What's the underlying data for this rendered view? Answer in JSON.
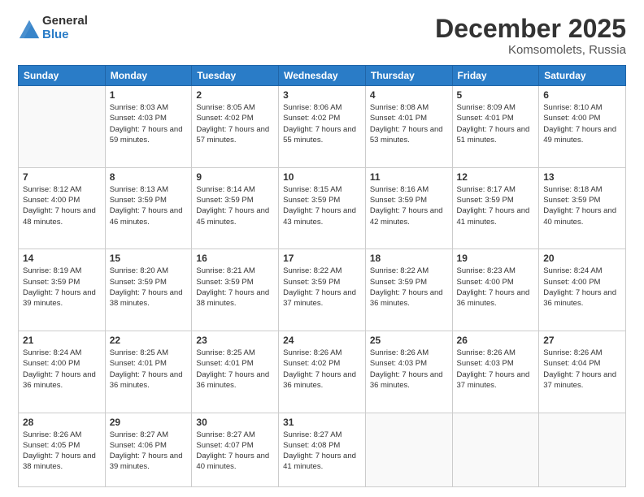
{
  "logo": {
    "general": "General",
    "blue": "Blue"
  },
  "header": {
    "month": "December 2025",
    "location": "Komsomolets, Russia"
  },
  "weekdays": [
    "Sunday",
    "Monday",
    "Tuesday",
    "Wednesday",
    "Thursday",
    "Friday",
    "Saturday"
  ],
  "weeks": [
    [
      {
        "day": "",
        "sunrise": "",
        "sunset": "",
        "daylight": ""
      },
      {
        "day": "1",
        "sunrise": "Sunrise: 8:03 AM",
        "sunset": "Sunset: 4:03 PM",
        "daylight": "Daylight: 7 hours and 59 minutes."
      },
      {
        "day": "2",
        "sunrise": "Sunrise: 8:05 AM",
        "sunset": "Sunset: 4:02 PM",
        "daylight": "Daylight: 7 hours and 57 minutes."
      },
      {
        "day": "3",
        "sunrise": "Sunrise: 8:06 AM",
        "sunset": "Sunset: 4:02 PM",
        "daylight": "Daylight: 7 hours and 55 minutes."
      },
      {
        "day": "4",
        "sunrise": "Sunrise: 8:08 AM",
        "sunset": "Sunset: 4:01 PM",
        "daylight": "Daylight: 7 hours and 53 minutes."
      },
      {
        "day": "5",
        "sunrise": "Sunrise: 8:09 AM",
        "sunset": "Sunset: 4:01 PM",
        "daylight": "Daylight: 7 hours and 51 minutes."
      },
      {
        "day": "6",
        "sunrise": "Sunrise: 8:10 AM",
        "sunset": "Sunset: 4:00 PM",
        "daylight": "Daylight: 7 hours and 49 minutes."
      }
    ],
    [
      {
        "day": "7",
        "sunrise": "Sunrise: 8:12 AM",
        "sunset": "Sunset: 4:00 PM",
        "daylight": "Daylight: 7 hours and 48 minutes."
      },
      {
        "day": "8",
        "sunrise": "Sunrise: 8:13 AM",
        "sunset": "Sunset: 3:59 PM",
        "daylight": "Daylight: 7 hours and 46 minutes."
      },
      {
        "day": "9",
        "sunrise": "Sunrise: 8:14 AM",
        "sunset": "Sunset: 3:59 PM",
        "daylight": "Daylight: 7 hours and 45 minutes."
      },
      {
        "day": "10",
        "sunrise": "Sunrise: 8:15 AM",
        "sunset": "Sunset: 3:59 PM",
        "daylight": "Daylight: 7 hours and 43 minutes."
      },
      {
        "day": "11",
        "sunrise": "Sunrise: 8:16 AM",
        "sunset": "Sunset: 3:59 PM",
        "daylight": "Daylight: 7 hours and 42 minutes."
      },
      {
        "day": "12",
        "sunrise": "Sunrise: 8:17 AM",
        "sunset": "Sunset: 3:59 PM",
        "daylight": "Daylight: 7 hours and 41 minutes."
      },
      {
        "day": "13",
        "sunrise": "Sunrise: 8:18 AM",
        "sunset": "Sunset: 3:59 PM",
        "daylight": "Daylight: 7 hours and 40 minutes."
      }
    ],
    [
      {
        "day": "14",
        "sunrise": "Sunrise: 8:19 AM",
        "sunset": "Sunset: 3:59 PM",
        "daylight": "Daylight: 7 hours and 39 minutes."
      },
      {
        "day": "15",
        "sunrise": "Sunrise: 8:20 AM",
        "sunset": "Sunset: 3:59 PM",
        "daylight": "Daylight: 7 hours and 38 minutes."
      },
      {
        "day": "16",
        "sunrise": "Sunrise: 8:21 AM",
        "sunset": "Sunset: 3:59 PM",
        "daylight": "Daylight: 7 hours and 38 minutes."
      },
      {
        "day": "17",
        "sunrise": "Sunrise: 8:22 AM",
        "sunset": "Sunset: 3:59 PM",
        "daylight": "Daylight: 7 hours and 37 minutes."
      },
      {
        "day": "18",
        "sunrise": "Sunrise: 8:22 AM",
        "sunset": "Sunset: 3:59 PM",
        "daylight": "Daylight: 7 hours and 36 minutes."
      },
      {
        "day": "19",
        "sunrise": "Sunrise: 8:23 AM",
        "sunset": "Sunset: 4:00 PM",
        "daylight": "Daylight: 7 hours and 36 minutes."
      },
      {
        "day": "20",
        "sunrise": "Sunrise: 8:24 AM",
        "sunset": "Sunset: 4:00 PM",
        "daylight": "Daylight: 7 hours and 36 minutes."
      }
    ],
    [
      {
        "day": "21",
        "sunrise": "Sunrise: 8:24 AM",
        "sunset": "Sunset: 4:00 PM",
        "daylight": "Daylight: 7 hours and 36 minutes."
      },
      {
        "day": "22",
        "sunrise": "Sunrise: 8:25 AM",
        "sunset": "Sunset: 4:01 PM",
        "daylight": "Daylight: 7 hours and 36 minutes."
      },
      {
        "day": "23",
        "sunrise": "Sunrise: 8:25 AM",
        "sunset": "Sunset: 4:01 PM",
        "daylight": "Daylight: 7 hours and 36 minutes."
      },
      {
        "day": "24",
        "sunrise": "Sunrise: 8:26 AM",
        "sunset": "Sunset: 4:02 PM",
        "daylight": "Daylight: 7 hours and 36 minutes."
      },
      {
        "day": "25",
        "sunrise": "Sunrise: 8:26 AM",
        "sunset": "Sunset: 4:03 PM",
        "daylight": "Daylight: 7 hours and 36 minutes."
      },
      {
        "day": "26",
        "sunrise": "Sunrise: 8:26 AM",
        "sunset": "Sunset: 4:03 PM",
        "daylight": "Daylight: 7 hours and 37 minutes."
      },
      {
        "day": "27",
        "sunrise": "Sunrise: 8:26 AM",
        "sunset": "Sunset: 4:04 PM",
        "daylight": "Daylight: 7 hours and 37 minutes."
      }
    ],
    [
      {
        "day": "28",
        "sunrise": "Sunrise: 8:26 AM",
        "sunset": "Sunset: 4:05 PM",
        "daylight": "Daylight: 7 hours and 38 minutes."
      },
      {
        "day": "29",
        "sunrise": "Sunrise: 8:27 AM",
        "sunset": "Sunset: 4:06 PM",
        "daylight": "Daylight: 7 hours and 39 minutes."
      },
      {
        "day": "30",
        "sunrise": "Sunrise: 8:27 AM",
        "sunset": "Sunset: 4:07 PM",
        "daylight": "Daylight: 7 hours and 40 minutes."
      },
      {
        "day": "31",
        "sunrise": "Sunrise: 8:27 AM",
        "sunset": "Sunset: 4:08 PM",
        "daylight": "Daylight: 7 hours and 41 minutes."
      },
      {
        "day": "",
        "sunrise": "",
        "sunset": "",
        "daylight": ""
      },
      {
        "day": "",
        "sunrise": "",
        "sunset": "",
        "daylight": ""
      },
      {
        "day": "",
        "sunrise": "",
        "sunset": "",
        "daylight": ""
      }
    ]
  ]
}
